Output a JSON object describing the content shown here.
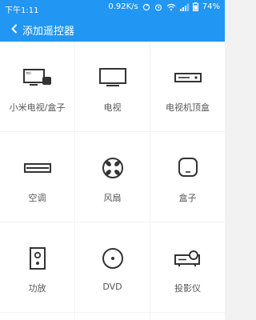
{
  "status_bar": {
    "time": "下午1:11",
    "net_speed": "0.92K/s",
    "battery": "74%"
  },
  "header": {
    "title": "添加遥控器",
    "accent_color": "#2196f3"
  },
  "devices": [
    {
      "label": "小米电视/盒子",
      "icon": "mi-tv-box-icon"
    },
    {
      "label": "电视",
      "icon": "tv-icon"
    },
    {
      "label": "电视机顶盒",
      "icon": "set-top-box-icon"
    },
    {
      "label": "空调",
      "icon": "air-conditioner-icon"
    },
    {
      "label": "风扇",
      "icon": "fan-icon"
    },
    {
      "label": "盒子",
      "icon": "box-icon"
    },
    {
      "label": "功放",
      "icon": "amplifier-icon"
    },
    {
      "label": "DVD",
      "icon": "dvd-icon"
    },
    {
      "label": "投影仪",
      "icon": "projector-icon"
    }
  ]
}
